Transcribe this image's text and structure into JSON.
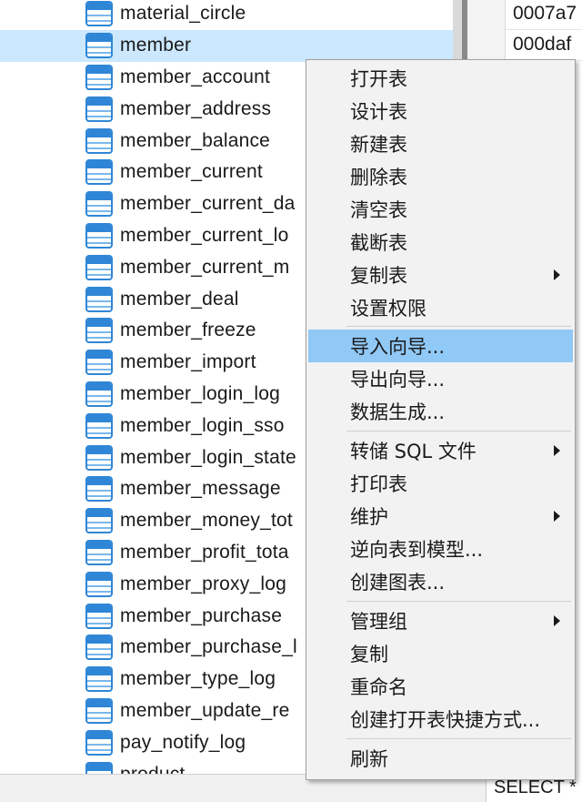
{
  "tree": {
    "items": [
      {
        "label": "material_circle"
      },
      {
        "label": "member"
      },
      {
        "label": "member_account"
      },
      {
        "label": "member_address"
      },
      {
        "label": "member_balance"
      },
      {
        "label": "member_current"
      },
      {
        "label": "member_current_da"
      },
      {
        "label": "member_current_lo"
      },
      {
        "label": "member_current_m"
      },
      {
        "label": "member_deal"
      },
      {
        "label": "member_freeze"
      },
      {
        "label": "member_import"
      },
      {
        "label": "member_login_log"
      },
      {
        "label": "member_login_sso"
      },
      {
        "label": "member_login_state"
      },
      {
        "label": "member_message"
      },
      {
        "label": "member_money_tot"
      },
      {
        "label": "member_profit_tota"
      },
      {
        "label": "member_proxy_log"
      },
      {
        "label": "member_purchase"
      },
      {
        "label": "member_purchase_l"
      },
      {
        "label": "member_type_log"
      },
      {
        "label": "member_update_re"
      },
      {
        "label": "pay_notify_log"
      },
      {
        "label": "product"
      }
    ]
  },
  "grid": {
    "cells": [
      "0007a7",
      "000daf"
    ]
  },
  "statusbar": {
    "sql": "SELECT * F"
  },
  "context_menu": {
    "items": [
      {
        "label": "打开表"
      },
      {
        "label": "设计表"
      },
      {
        "label": "新建表"
      },
      {
        "label": "删除表"
      },
      {
        "label": "清空表"
      },
      {
        "label": "截断表"
      },
      {
        "label": "复制表"
      },
      {
        "label": "设置权限"
      },
      {
        "label": "导入向导..."
      },
      {
        "label": "导出向导..."
      },
      {
        "label": "数据生成..."
      },
      {
        "label": "转储 SQL 文件"
      },
      {
        "label": "打印表"
      },
      {
        "label": "维护"
      },
      {
        "label": "逆向表到模型..."
      },
      {
        "label": "创建图表..."
      },
      {
        "label": "管理组"
      },
      {
        "label": "复制"
      },
      {
        "label": "重命名"
      },
      {
        "label": "创建打开表快捷方式..."
      },
      {
        "label": "刷新"
      }
    ]
  },
  "colors": {
    "selection": "#cce8ff",
    "menu_highlight": "#90c8f6",
    "table_icon": "#2f86d6"
  }
}
